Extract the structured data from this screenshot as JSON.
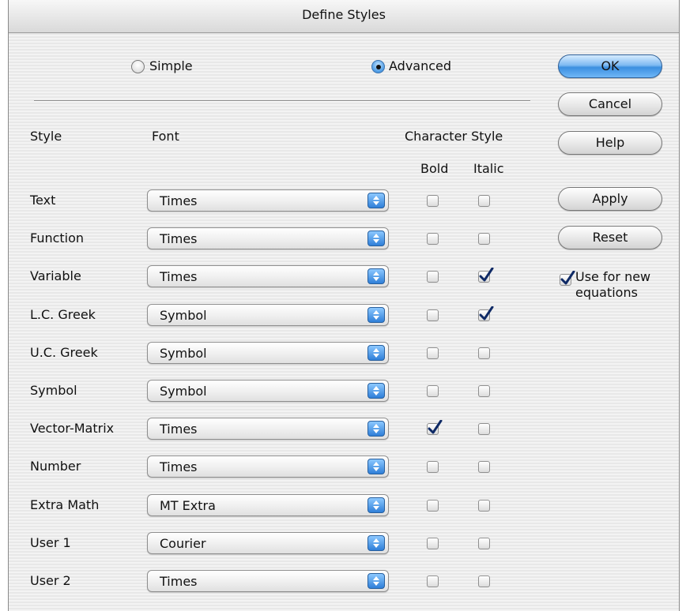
{
  "dialog": {
    "title": "Define Styles"
  },
  "mode": {
    "simple_label": "Simple",
    "advanced_label": "Advanced",
    "selected": "Advanced"
  },
  "buttons": {
    "ok": "OK",
    "cancel": "Cancel",
    "help": "Help",
    "apply": "Apply",
    "reset": "Reset"
  },
  "use_new": {
    "line1": "Use for new",
    "line2": "equations",
    "checked": true
  },
  "headers": {
    "style": "Style",
    "font": "Font",
    "char_style": "Character Style",
    "bold": "Bold",
    "italic": "Italic"
  },
  "rows": [
    {
      "style": "Text",
      "font": "Times",
      "bold": false,
      "italic": false
    },
    {
      "style": "Function",
      "font": "Times",
      "bold": false,
      "italic": false
    },
    {
      "style": "Variable",
      "font": "Times",
      "bold": false,
      "italic": true
    },
    {
      "style": "L.C. Greek",
      "font": "Symbol",
      "bold": false,
      "italic": true
    },
    {
      "style": "U.C. Greek",
      "font": "Symbol",
      "bold": false,
      "italic": false
    },
    {
      "style": "Symbol",
      "font": "Symbol",
      "bold": false,
      "italic": false
    },
    {
      "style": "Vector-Matrix",
      "font": "Times",
      "bold": true,
      "italic": false
    },
    {
      "style": "Number",
      "font": "Times",
      "bold": false,
      "italic": false
    },
    {
      "style": "Extra Math",
      "font": "MT Extra",
      "bold": false,
      "italic": false
    },
    {
      "style": "User 1",
      "font": "Courier",
      "bold": false,
      "italic": false
    },
    {
      "style": "User 2",
      "font": "Times",
      "bold": false,
      "italic": false
    }
  ],
  "colors": {
    "accent": "#3c8fe0",
    "checkmark": "#0f2a66"
  },
  "icons": {
    "popup_arrows": "up-down-arrows-icon",
    "checkmark": "checkmark-icon"
  }
}
